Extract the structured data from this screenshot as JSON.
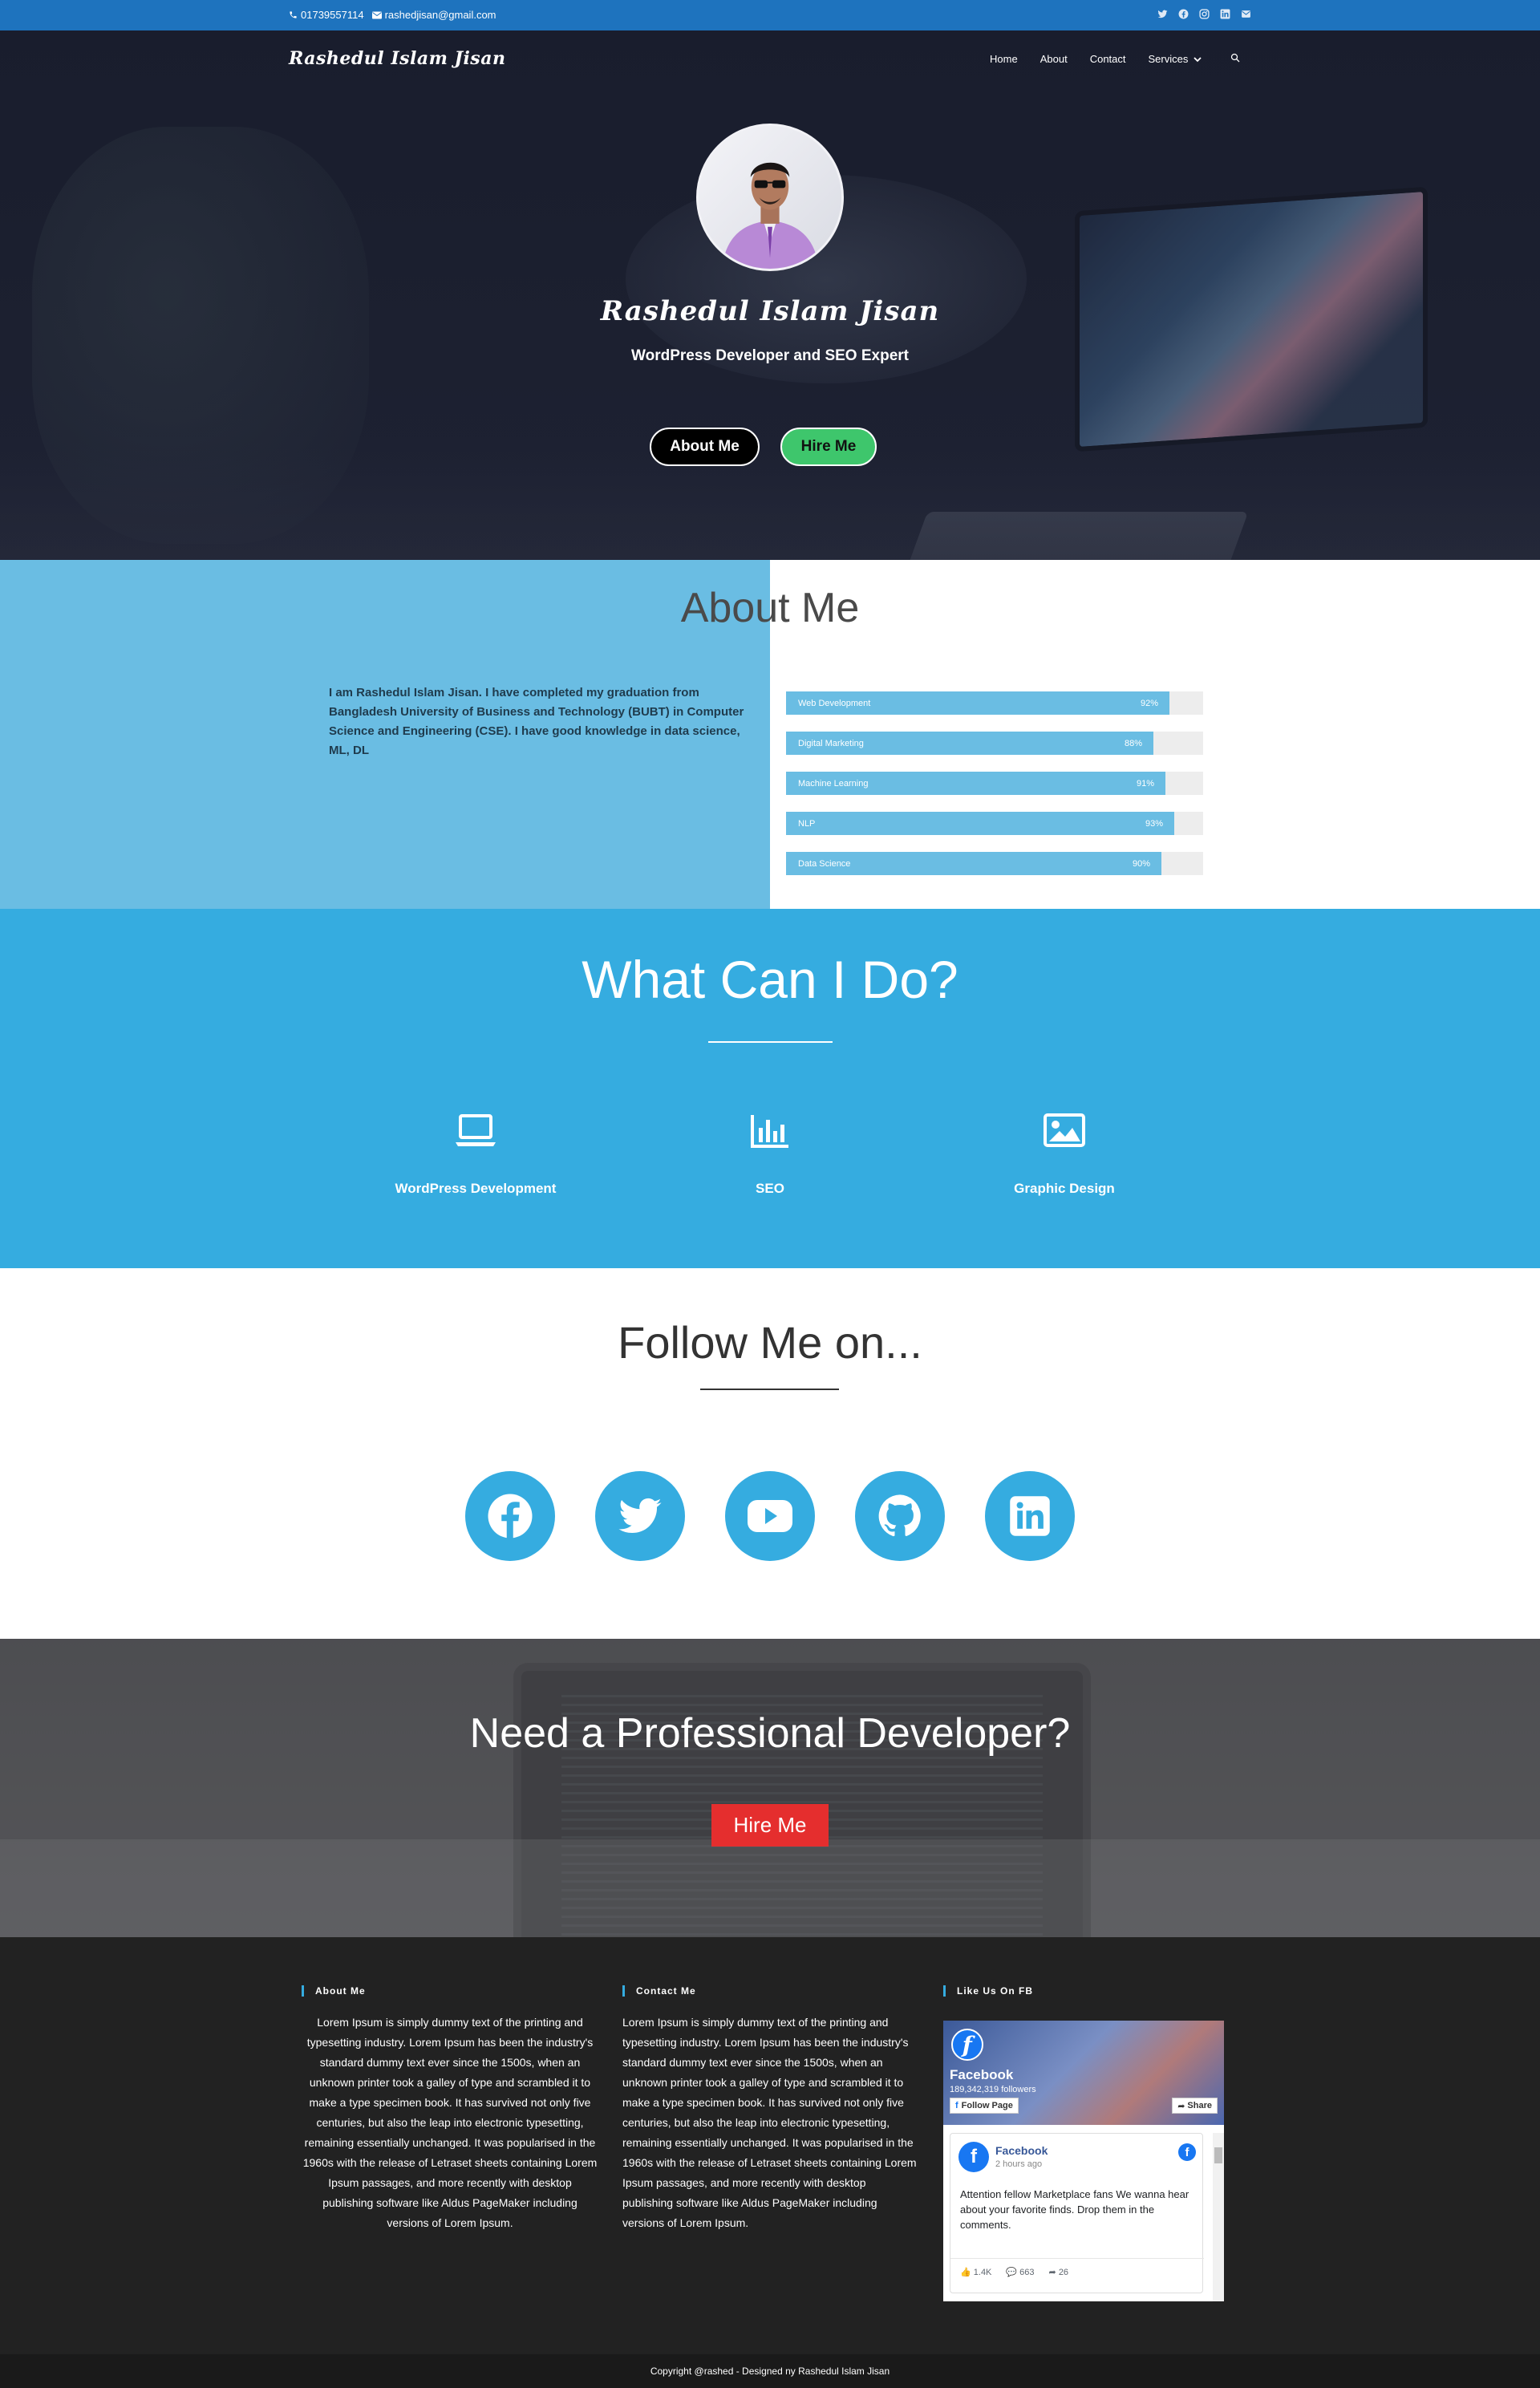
{
  "topbar": {
    "phone": "01739557114",
    "email": "rashedjisan@gmail.com",
    "socials": [
      "twitter-icon",
      "facebook-icon",
      "instagram-icon",
      "linkedin-icon",
      "email-icon"
    ]
  },
  "nav": {
    "logo": "Rashedul Islam Jisan",
    "items": [
      "Home",
      "About",
      "Contact",
      "Services"
    ]
  },
  "hero": {
    "name": "Rashedul Islam Jisan",
    "subtitle": "WordPress Developer and SEO Expert",
    "about_button": "About Me",
    "hire_button": "Hire Me"
  },
  "about": {
    "title": "About Me",
    "text": "I am Rashedul Islam Jisan. I have completed my graduation from Bangladesh University of Business and Technology (BUBT) in Computer Science and Engineering (CSE). I have good knowledge in data science, ML, DL",
    "skills": [
      {
        "name": "Web Development",
        "percent": 92,
        "label": "92%"
      },
      {
        "name": "Digital Marketing",
        "percent": 88,
        "label": "88%"
      },
      {
        "name": "Machine Learning",
        "percent": 91,
        "label": "91%"
      },
      {
        "name": "NLP",
        "percent": 93,
        "label": "93%"
      },
      {
        "name": "Data Science",
        "percent": 90,
        "label": "90%"
      }
    ]
  },
  "services": {
    "title": "What Can I Do?",
    "items": [
      {
        "label": "WordPress Development",
        "icon": "laptop-icon"
      },
      {
        "label": "SEO",
        "icon": "bar-chart-icon"
      },
      {
        "label": "Graphic Design",
        "icon": "image-icon"
      }
    ]
  },
  "follow": {
    "title": "Follow Me on...",
    "icons": [
      "facebook-icon",
      "twitter-icon",
      "youtube-icon",
      "github-icon",
      "linkedin-icon"
    ]
  },
  "cta": {
    "title": "Need a Professional Developer?",
    "button": "Hire Me"
  },
  "footer": {
    "about_title": "About Me",
    "about_text": "Lorem Ipsum is simply dummy text of the printing and typesetting industry. Lorem Ipsum has been the industry's standard dummy text ever since the 1500s, when an unknown printer took a galley of type and scrambled it to make a type specimen book. It has survived not only five centuries, but also the leap into electronic typesetting, remaining essentially unchanged. It was popularised in the 1960s with the release of Letraset sheets containing Lorem Ipsum passages, and more recently with desktop publishing software like Aldus PageMaker including versions of Lorem Ipsum.",
    "contact_title": "Contact Me",
    "contact_text": "Lorem Ipsum is simply dummy text of the printing and typesetting industry. Lorem Ipsum has been the industry's standard dummy text ever since the 1500s, when an unknown printer took a galley of type and scrambled it to make a type specimen book. It has survived not only five centuries, but also the leap into electronic typesetting, remaining essentially unchanged. It was popularised in the 1960s with the release of Letraset sheets containing Lorem Ipsum passages, and more recently with desktop publishing software like Aldus PageMaker including versions of Lorem Ipsum.",
    "fb_title": "Like Us On FB",
    "fb_widget": {
      "page_name": "Facebook",
      "followers": "189,342,319 followers",
      "follow_label": "Follow Page",
      "share_label": "Share",
      "post_author": "Facebook",
      "post_time": "2 hours ago",
      "post_text": "Attention fellow Marketplace fans We wanna hear about your favorite finds. Drop them in the comments.",
      "likes": "1.4K",
      "comments": "663",
      "shares": "26"
    },
    "copyright": "Copyright @rashed - Designed ny Rashedul Islam Jisan"
  },
  "colors": {
    "topbar": "#1e73be",
    "accent": "#35ace0",
    "about_left": "#6abde3",
    "hire_green": "#3ec66c",
    "cta_red": "#e52e2e",
    "footer": "#222222"
  }
}
